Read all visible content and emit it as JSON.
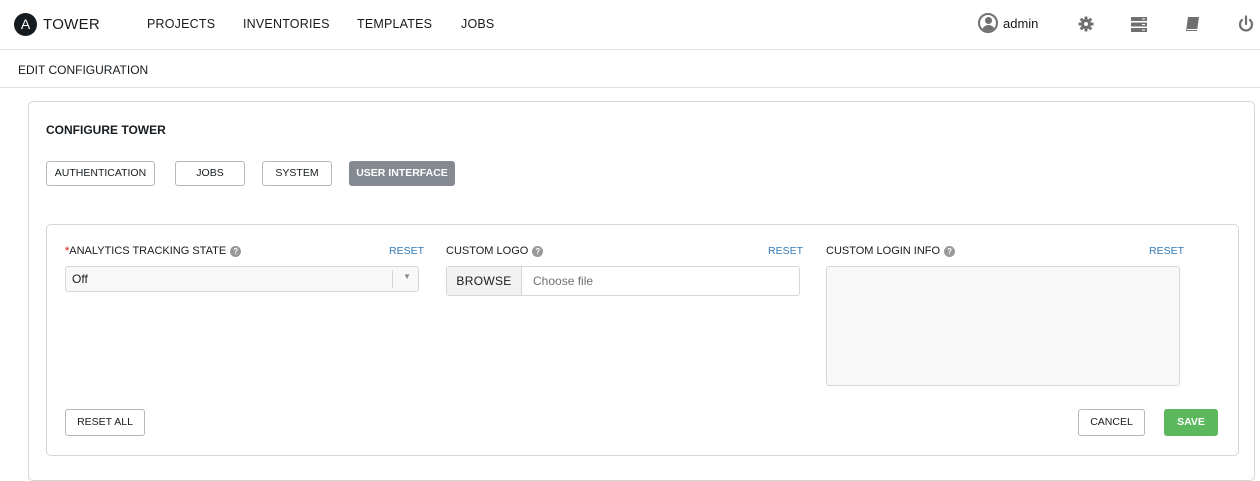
{
  "nav": {
    "logo_letter": "A",
    "brand": "TOWER",
    "links": [
      "PROJECTS",
      "INVENTORIES",
      "TEMPLATES",
      "JOBS"
    ],
    "user": "admin",
    "icons": [
      "user-icon",
      "gear-icon",
      "server-list-icon",
      "book-icon",
      "power-icon"
    ]
  },
  "breadcrumb": "EDIT CONFIGURATION",
  "panel": {
    "title": "CONFIGURE TOWER",
    "tabs": [
      {
        "label": "AUTHENTICATION",
        "active": false
      },
      {
        "label": "JOBS",
        "active": false
      },
      {
        "label": "SYSTEM",
        "active": false
      },
      {
        "label": "USER INTERFACE",
        "active": true
      }
    ]
  },
  "form": {
    "analytics": {
      "required_mark": "*",
      "label": "ANALYTICS TRACKING STATE",
      "reset": "RESET",
      "value": "Off"
    },
    "logo": {
      "label": "CUSTOM LOGO",
      "reset": "RESET",
      "browse": "BROWSE",
      "placeholder": "Choose file"
    },
    "login_info": {
      "label": "CUSTOM LOGIN INFO",
      "reset": "RESET",
      "value": ""
    },
    "help_glyph": "?",
    "caret": "▼",
    "reset_all": "RESET ALL",
    "cancel": "CANCEL",
    "save": "SAVE"
  },
  "colors": {
    "save": "#5cb85c",
    "active_tab": "#848992",
    "link": "#337ab7",
    "required": "#d9534f"
  }
}
